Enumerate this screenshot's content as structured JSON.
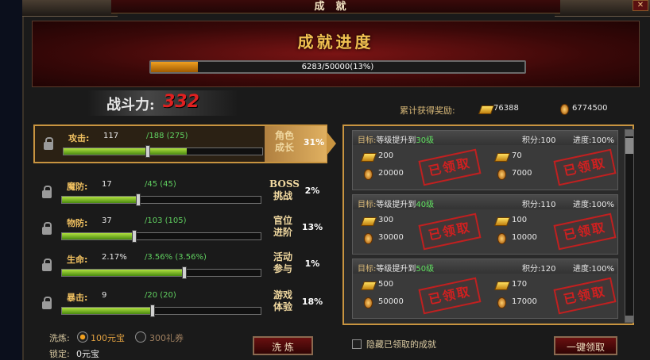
{
  "window": {
    "title": "成就"
  },
  "banner": {
    "title": "成就进度",
    "progress_text": "6283/50000(13%)",
    "progress_fraction": 0.1257
  },
  "power": {
    "label": "战斗力:",
    "value": "332"
  },
  "rewards_total": {
    "label": "累计获得奖励:",
    "gold": "76388",
    "coin": "6774500"
  },
  "categories": [
    {
      "stat": "攻击:",
      "cur": "117",
      "max": "/188 (275)",
      "fill": 0.62,
      "knob": 0.42,
      "name": "角色成长",
      "pct": "31%",
      "selected": true
    },
    {
      "stat": "魔防:",
      "cur": "17",
      "max": "/45 (45)",
      "fill": 0.38,
      "knob": 0.38,
      "name": "BOSS挑战",
      "pct": "2%",
      "selected": false
    },
    {
      "stat": "物防:",
      "cur": "37",
      "max": "/103 (105)",
      "fill": 0.36,
      "knob": 0.36,
      "name": "官位进阶",
      "pct": "13%",
      "selected": false
    },
    {
      "stat": "生命:",
      "cur": "2.17%",
      "max": "/3.56% (3.56%)",
      "fill": 0.61,
      "knob": 0.61,
      "name": "活动参与",
      "pct": "1%",
      "selected": false
    },
    {
      "stat": "暴击:",
      "cur": "9",
      "max": "/20 (20)",
      "fill": 0.45,
      "knob": 0.45,
      "name": "游戏体验",
      "pct": "18%",
      "selected": false
    }
  ],
  "goals": [
    {
      "prefix": "目标:",
      "text": "等级提升到",
      "level": "30级",
      "points": "积分:100",
      "progress": "进度:100%",
      "r1_gold": "200",
      "r1_coin": "20000",
      "r2_gold": "70",
      "r2_coin": "7000",
      "stamp": "已领取"
    },
    {
      "prefix": "目标:",
      "text": "等级提升到",
      "level": "40级",
      "points": "积分:110",
      "progress": "进度:100%",
      "r1_gold": "300",
      "r1_coin": "30000",
      "r2_gold": "100",
      "r2_coin": "10000",
      "stamp": "已领取"
    },
    {
      "prefix": "目标:",
      "text": "等级提升到",
      "level": "50级",
      "points": "积分:120",
      "progress": "进度:100%",
      "r1_gold": "500",
      "r1_coin": "50000",
      "r2_gold": "170",
      "r2_coin": "17000",
      "stamp": "已领取"
    }
  ],
  "bottom": {
    "wash_label": "洗炼:",
    "option1": "100元宝",
    "option2": "300礼券",
    "lock_label": "锁定:",
    "lock_value": "0元宝",
    "wash_button": "洗 炼",
    "hide_label": "隐藏已领取的成就",
    "claim_all_button": "一键领取"
  },
  "close_icon": "close-icon",
  "colors": {
    "accent_gold": "#c89440",
    "stamp_red": "#c02020",
    "level_green": "#60e060"
  }
}
